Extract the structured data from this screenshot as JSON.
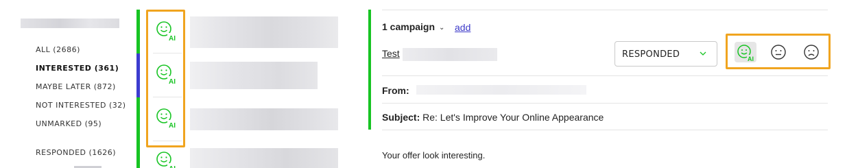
{
  "sidebar": {
    "filters": [
      {
        "label": "ALL (2686)",
        "active": false
      },
      {
        "label": "INTERESTED (361)",
        "active": true
      },
      {
        "label": "MAYBE LATER (872)",
        "active": false
      },
      {
        "label": "NOT INTERESTED (32)",
        "active": false
      },
      {
        "label": "UNMARKED (95)",
        "active": false
      },
      {
        "label": "RESPONDED (1626)",
        "active": false
      }
    ]
  },
  "list": {
    "rows": [
      {
        "bar_color": "#17c423",
        "icon": "ai-smile-icon"
      },
      {
        "bar_color": "#3c3ccf",
        "icon": "ai-smile-icon"
      },
      {
        "bar_color": "#17c423",
        "icon": "ai-smile-icon"
      },
      {
        "bar_color": "#17c423",
        "icon": "ai-smile-icon"
      }
    ],
    "icon_badge": "AI"
  },
  "detail": {
    "campaign_label": "1 campaign",
    "campaign_caret": "⌄",
    "add_label": "add",
    "lead_name": "Test",
    "status_value": "RESPONDED",
    "sentiment": {
      "active": "ai-positive",
      "badge": "AI",
      "buttons": [
        "ai-smile-icon",
        "neutral-face-icon",
        "sad-face-icon"
      ]
    },
    "from_label": "From:",
    "subject_label": "Subject:",
    "subject_value": "Re: Let's Improve Your Online Appearance",
    "body": "Your offer look interesting."
  },
  "colors": {
    "accent_green": "#17c423",
    "accent_blue": "#3c3ccf",
    "highlight_orange": "#f0a41f",
    "link": "#3c39c9"
  }
}
